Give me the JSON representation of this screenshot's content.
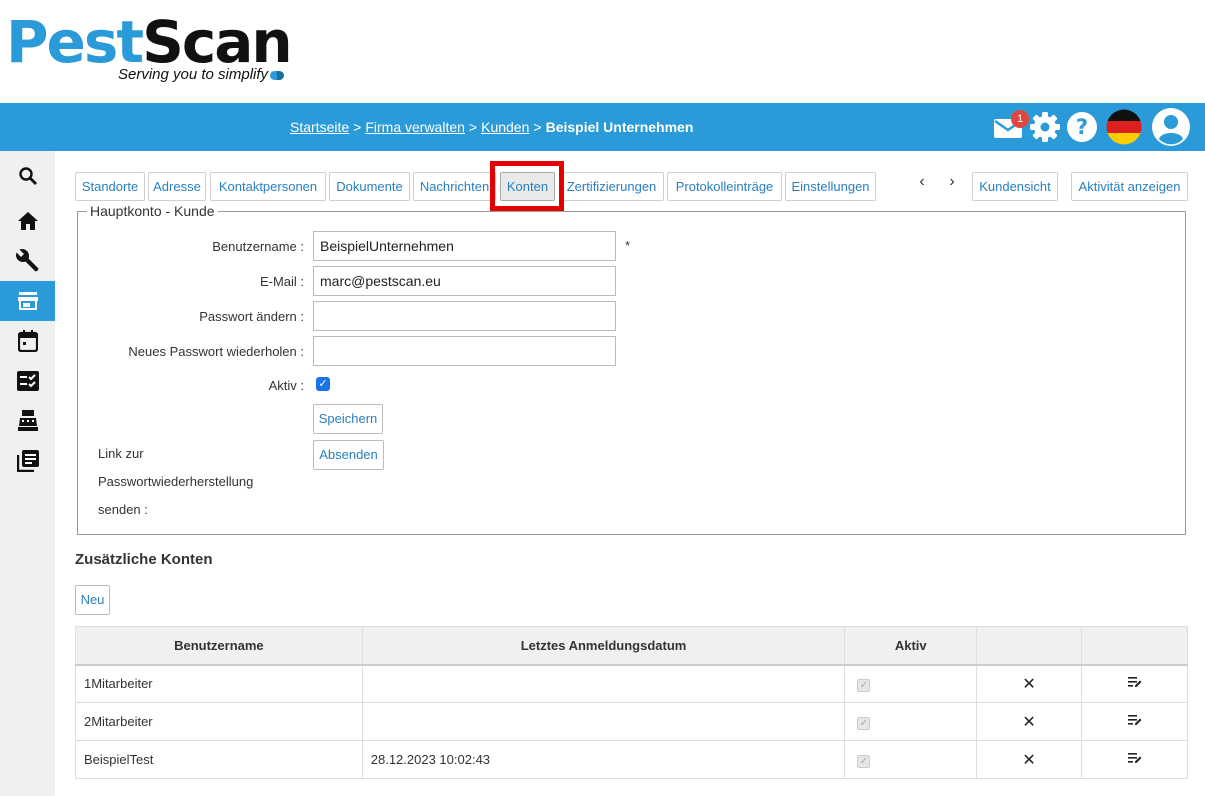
{
  "logo": {
    "brand_part1": "Pest",
    "brand_part2": "Scan",
    "tagline": "Serving you to simplify"
  },
  "breadcrumb": {
    "items": [
      "Startseite",
      "Firma verwalten",
      "Kunden"
    ],
    "separator": ">",
    "current": "Beispiel Unternehmen"
  },
  "header": {
    "mail_badge": "1"
  },
  "sidebar": {
    "items": [
      {
        "icon": "search-icon"
      },
      {
        "icon": "home-icon"
      },
      {
        "icon": "wrench-icon"
      },
      {
        "icon": "store-icon",
        "active": true
      },
      {
        "icon": "calendar-icon"
      },
      {
        "icon": "checklist-icon"
      },
      {
        "icon": "cash-register-icon"
      },
      {
        "icon": "library-icon"
      }
    ]
  },
  "tabs": [
    "Standorte",
    "Adresse",
    "Kontaktpersonen",
    "Dokumente",
    "Nachrichten",
    "Konten",
    "Zertifizierungen",
    "Protokolleinträge",
    "Einstellungen"
  ],
  "active_tab": "Konten",
  "tab_nav": {
    "prev": "‹",
    "next": "›"
  },
  "right_buttons": {
    "customer_view": "Kundensicht",
    "show_activity": "Aktivität anzeigen"
  },
  "main_account": {
    "legend": "Hauptkonto - Kunde",
    "username_label": "Benutzername :",
    "username_value": "BeispielUnternehmen",
    "required_mark": "*",
    "email_label": "E-Mail :",
    "email_value": "marc@pestscan.eu",
    "password_label": "Passwort ändern :",
    "password_repeat_label": "Neues Passwort wiederholen :",
    "active_label": "Aktiv :",
    "active_checked": true,
    "save_button": "Speichern",
    "reset_link_label": "Link zur Passwortwiederherstellung senden :",
    "send_button": "Absenden"
  },
  "additional_accounts": {
    "title": "Zusätzliche Konten",
    "new_button": "Neu",
    "columns": [
      "Benutzername",
      "Letztes Anmeldungsdatum",
      "Aktiv",
      "",
      ""
    ],
    "rows": [
      {
        "username": "1Mitarbeiter",
        "last_login": "",
        "active": true
      },
      {
        "username": "2Mitarbeiter",
        "last_login": "",
        "active": true
      },
      {
        "username": "BeispielTest",
        "last_login": "28.12.2023 10:02:43",
        "active": true
      }
    ]
  },
  "colors": {
    "primary": "#2a9ad8",
    "highlight": "#e50000",
    "badge": "#e0463e"
  }
}
